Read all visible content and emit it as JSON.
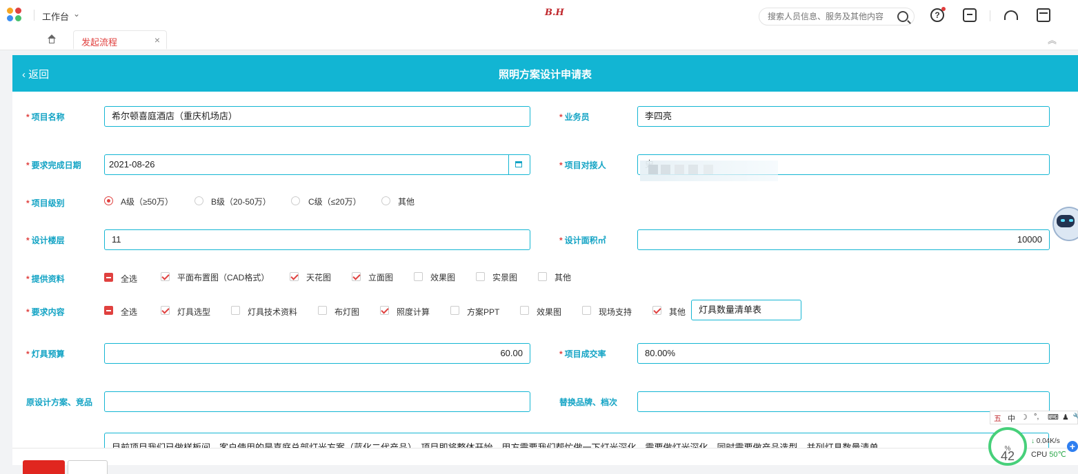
{
  "topbar": {
    "workspace": "工作台",
    "brand": "B.H",
    "search_placeholder": "搜索人员信息、服务及其他内容",
    "help_glyph": "?"
  },
  "tabs": [
    {
      "label": "发起流程",
      "close": "×"
    }
  ],
  "page": {
    "back_label": "返回",
    "title": "照明方案设计申请表"
  },
  "form": {
    "project_name": {
      "label": "项目名称",
      "value": "希尔顿喜庭酒店（重庆机场店）"
    },
    "salesperson": {
      "label": "业务员",
      "value": "李四亮"
    },
    "due_date": {
      "label": "要求完成日期",
      "value": "2021-08-26"
    },
    "project_contact": {
      "label": "项目对接人",
      "value": "史"
    },
    "project_level": {
      "label": "项目级别",
      "options": [
        "A级（≥50万）",
        "B级（20-50万）",
        "C级（≤20万）",
        "其他"
      ],
      "selected": "A级（≥50万）"
    },
    "design_floors": {
      "label": "设计楼层",
      "value": "11"
    },
    "design_area": {
      "label": "设计面积㎡",
      "value": "10000"
    },
    "provided_materials": {
      "label": "提供资料",
      "select_all": "全选",
      "options": [
        "平面布置图（CAD格式）",
        "天花图",
        "立面图",
        "效果图",
        "实景图",
        "其他"
      ],
      "checked": [
        "平面布置图（CAD格式）",
        "天花图",
        "立面图"
      ]
    },
    "required_content": {
      "label": "要求内容",
      "select_all": "全选",
      "options": [
        "灯具选型",
        "灯具技术资料",
        "布灯图",
        "照度计算",
        "方案PPT",
        "效果图",
        "现场支持",
        "其他"
      ],
      "checked": [
        "灯具选型",
        "照度计算",
        "其他"
      ],
      "other_value": "灯具数量清单表"
    },
    "fixture_budget": {
      "label": "灯具预算",
      "value": "60.00"
    },
    "deal_rate": {
      "label": "项目成交率",
      "value": "80.00%"
    },
    "original_design": {
      "label": "原设计方案、竞品",
      "value": ""
    },
    "replacement_brand": {
      "label": "替换品牌、档次",
      "value": ""
    },
    "notes": {
      "value": "目前项目我们已做样板间，客户使用的是喜庭总部灯光方案（蓝化二代产品），项目即将整体开始，甲方需要我们帮忙做一下灯光深化，需要做灯光深化，同时需要做产品选型，并列灯具数量清单"
    }
  },
  "tray": {
    "ime": [
      "五",
      "中",
      "☽",
      "°,",
      "⌨",
      "♟",
      "🔧"
    ],
    "gauge_value": "42",
    "gauge_unit": "%",
    "net_speed": "0.04K/s",
    "cpu_label": "CPU",
    "cpu_temp": "50℃",
    "plus": "+"
  }
}
